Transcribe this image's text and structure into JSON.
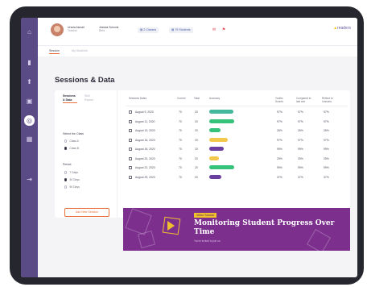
{
  "colors": {
    "sidebar": "#5a4a86",
    "accent": "#e8703a",
    "bar_teal": "#43b89a",
    "bar_green": "#36c27a",
    "bar_yellow": "#f2c94c",
    "bar_purple": "#6a3fa0",
    "banner": "#7d2f8e"
  },
  "sidebar": {
    "items": [
      {
        "icon": "home-icon",
        "glyph": "⌂"
      },
      {
        "icon": "bar-chart-icon",
        "glyph": "▮"
      },
      {
        "icon": "rocket-icon",
        "glyph": "⬆"
      },
      {
        "icon": "book-icon",
        "glyph": "▣"
      },
      {
        "icon": "target-icon",
        "glyph": "◎"
      },
      {
        "icon": "grid-icon",
        "glyph": "▦"
      },
      {
        "icon": "logout-icon",
        "glyph": "⇥"
      }
    ]
  },
  "header": {
    "user_name": "Ursula Asmail",
    "user_role": "Teacher",
    "school_name": "Jessica Schools",
    "school_sub": "Beta",
    "classes_pill": "2 Classes",
    "students_pill": "79 Students",
    "logo_text": "readers"
  },
  "subtabs": {
    "active": "Session",
    "inactive": "My Students"
  },
  "page": {
    "title": "Sessions & Data"
  },
  "filters": {
    "tab_active": "Sessions & Data",
    "tab_inactive": "Skill Report",
    "class_label": "Select the Class",
    "classes": [
      {
        "label": "Class A",
        "selected": false
      },
      {
        "label": "Class B",
        "selected": true
      }
    ],
    "period_label": "Period",
    "periods": [
      {
        "label": "7 Days",
        "selected": false
      },
      {
        "label": "30 Days",
        "selected": true
      },
      {
        "label": "90 Days",
        "selected": false
      }
    ],
    "add_button": "Add New Session"
  },
  "table": {
    "headers": [
      "Sessions Dates",
      "Correct",
      "Total",
      "Accuracy",
      "Youths Scores",
      "Compared to last one",
      "Reflect to Lessons"
    ],
    "rows": [
      {
        "date": "August 9, 2020",
        "correct": "70",
        "total": "20",
        "accuracy": 87,
        "bar_color": "#43b89a",
        "c1": "97%",
        "c2": "97%",
        "c3": "97%"
      },
      {
        "date": "August 11, 2020",
        "correct": "70",
        "total": "20",
        "accuracy": 90,
        "bar_color": "#36c27a",
        "c1": "97%",
        "c2": "97%",
        "c3": "97%"
      },
      {
        "date": "August 13, 2020",
        "correct": "70",
        "total": "20",
        "accuracy": 40,
        "bar_color": "#36c27a",
        "c1": "26%",
        "c2": "26%",
        "c3": "26%"
      },
      {
        "date": "August 16, 2020",
        "correct": "70",
        "total": "20",
        "accuracy": 68,
        "bar_color": "#f2c94c",
        "c1": "97%",
        "c2": "97%",
        "c3": "97%"
      },
      {
        "date": "August 18, 2020",
        "correct": "70",
        "total": "20",
        "accuracy": 52,
        "bar_color": "#6a3fa0",
        "c1": "99%",
        "c2": "99%",
        "c3": "99%"
      },
      {
        "date": "August 20, 2020",
        "correct": "70",
        "total": "20",
        "accuracy": 35,
        "bar_color": "#f2c94c",
        "c1": "29%",
        "c2": "29%",
        "c3": "29%"
      },
      {
        "date": "August 22, 2020",
        "correct": "70",
        "total": "20",
        "accuracy": 90,
        "bar_color": "#36c27a",
        "c1": "99%",
        "c2": "99%",
        "c3": "99%"
      },
      {
        "date": "August 25, 2020",
        "correct": "70",
        "total": "20",
        "accuracy": 45,
        "bar_color": "#6a3fa0",
        "c1": "37%",
        "c2": "37%",
        "c3": "37%"
      }
    ]
  },
  "banner": {
    "tag": "Video Tutorial",
    "title": "Monitoring Student Progress Over Time",
    "subtitle": "You're invited to join us"
  }
}
